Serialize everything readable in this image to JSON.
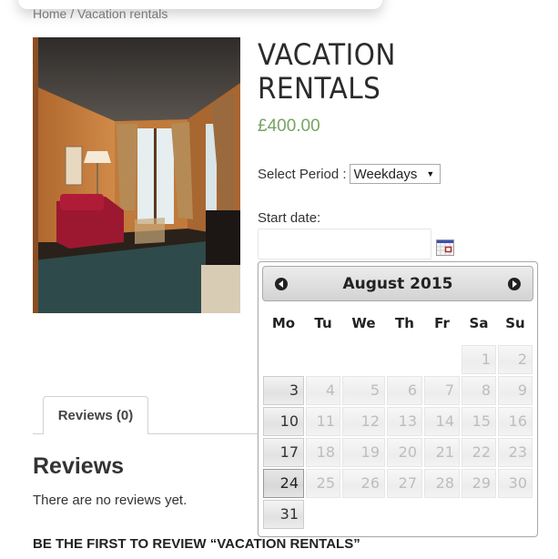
{
  "breadcrumb": {
    "items": [
      "Home",
      "Vacation rentals"
    ],
    "separator": " / "
  },
  "product": {
    "image_alt": "hotel-room-photo",
    "title_line1": "VACATION",
    "title_line2": "RENTALS",
    "price": "£400.00",
    "price_color": "#77a464"
  },
  "booking": {
    "period_label": "Select Period :",
    "period_selected": "Weekdays",
    "start_date_label": "Start date:",
    "start_date_value": "",
    "calendar_icon": "calendar-icon"
  },
  "datepicker": {
    "month_title": "August 2015",
    "prev_icon": "circle-arrow-left-icon",
    "next_icon": "circle-arrow-right-icon",
    "weekdays": [
      "Mo",
      "Tu",
      "We",
      "Th",
      "Fr",
      "Sa",
      "Su"
    ],
    "weeks": [
      [
        "",
        "",
        "",
        "",
        "",
        "1",
        "2"
      ],
      [
        "3",
        "4",
        "5",
        "6",
        "7",
        "8",
        "9"
      ],
      [
        "10",
        "11",
        "12",
        "13",
        "14",
        "15",
        "16"
      ],
      [
        "17",
        "18",
        "19",
        "20",
        "21",
        "22",
        "23"
      ],
      [
        "24",
        "25",
        "26",
        "27",
        "28",
        "29",
        "30"
      ],
      [
        "31",
        "",
        "",
        "",
        "",
        "",
        ""
      ]
    ],
    "enabled_days": [
      "3",
      "10",
      "17",
      "24",
      "31"
    ],
    "active_day": "24"
  },
  "tabs": [
    {
      "label": "Reviews (0)",
      "active": true
    }
  ],
  "reviews": {
    "heading": "Reviews",
    "empty_text": "There are no reviews yet.",
    "prompt": "BE THE FIRST TO REVIEW “VACATION RENTALS”"
  }
}
